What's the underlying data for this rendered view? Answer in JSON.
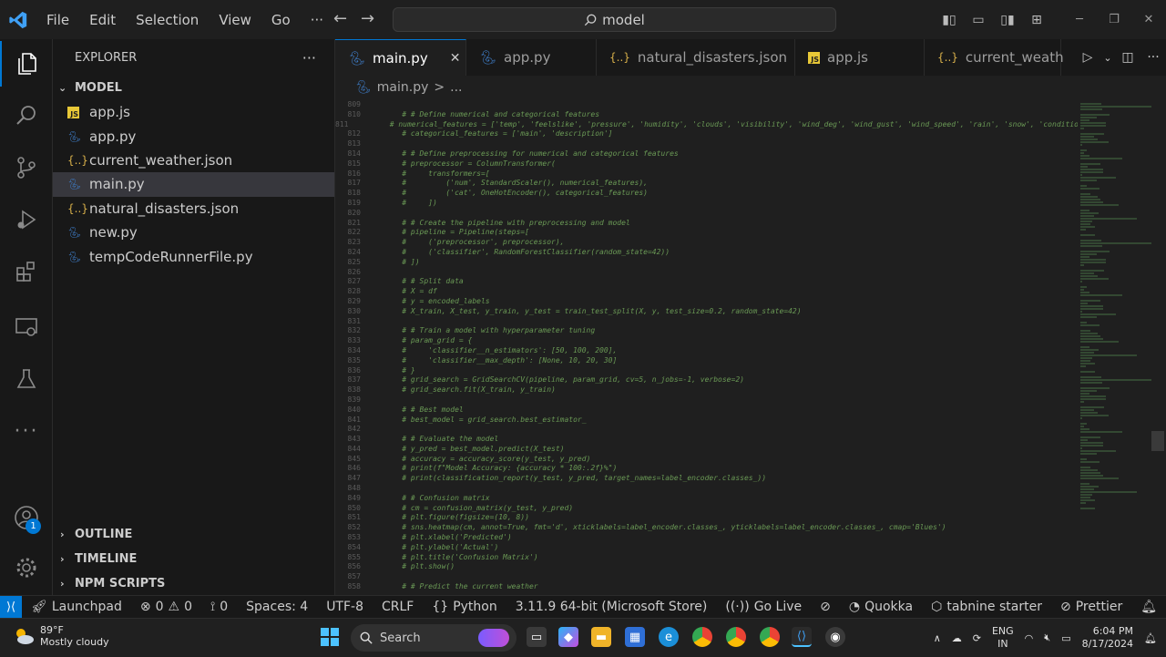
{
  "titlebar": {
    "menu": [
      "File",
      "Edit",
      "Selection",
      "View",
      "Go"
    ],
    "more": "···",
    "search_text": "model"
  },
  "sidebar": {
    "title": "EXPLORER",
    "more": "···",
    "folder": "MODEL",
    "files": [
      {
        "name": "app.js",
        "icon": "js"
      },
      {
        "name": "app.py",
        "icon": "py"
      },
      {
        "name": "current_weather.json",
        "icon": "json"
      },
      {
        "name": "main.py",
        "icon": "py",
        "selected": true
      },
      {
        "name": "natural_disasters.json",
        "icon": "json"
      },
      {
        "name": "new.py",
        "icon": "py"
      },
      {
        "name": "tempCodeRunnerFile.py",
        "icon": "py"
      }
    ],
    "sections": [
      "OUTLINE",
      "TIMELINE",
      "NPM SCRIPTS"
    ]
  },
  "activity_badge": "1",
  "tabs": [
    {
      "label": "main.py",
      "icon": "py",
      "active": true
    },
    {
      "label": "app.py",
      "icon": "py"
    },
    {
      "label": "natural_disasters.json",
      "icon": "json"
    },
    {
      "label": "app.js",
      "icon": "js"
    },
    {
      "label": "current_weath",
      "icon": "json"
    }
  ],
  "breadcrumb": {
    "file": "main.py",
    "sep": ">",
    "rest": "..."
  },
  "code_lines": [
    {
      "n": "809",
      "t": ""
    },
    {
      "n": "810",
      "t": "    # # Define numerical and categorical features"
    },
    {
      "n": "811",
      "t": "    # numerical_features = ['temp', 'feelslike', 'pressure', 'humidity', 'clouds', 'visibility', 'wind_deg', 'wind_gust', 'wind_speed', 'rain', 'snow', 'conditionId']"
    },
    {
      "n": "812",
      "t": "    # categorical_features = ['main', 'description']"
    },
    {
      "n": "813",
      "t": ""
    },
    {
      "n": "814",
      "t": "    # # Define preprocessing for numerical and categorical features"
    },
    {
      "n": "815",
      "t": "    # preprocessor = ColumnTransformer("
    },
    {
      "n": "816",
      "t": "    #     transformers=["
    },
    {
      "n": "817",
      "t": "    #         ('num', StandardScaler(), numerical_features),"
    },
    {
      "n": "818",
      "t": "    #         ('cat', OneHotEncoder(), categorical_features)"
    },
    {
      "n": "819",
      "t": "    #     ])"
    },
    {
      "n": "820",
      "t": ""
    },
    {
      "n": "821",
      "t": "    # # Create the pipeline with preprocessing and model"
    },
    {
      "n": "822",
      "t": "    # pipeline = Pipeline(steps=["
    },
    {
      "n": "823",
      "t": "    #     ('preprocessor', preprocessor),"
    },
    {
      "n": "824",
      "t": "    #     ('classifier', RandomForestClassifier(random_state=42))"
    },
    {
      "n": "825",
      "t": "    # ])"
    },
    {
      "n": "826",
      "t": ""
    },
    {
      "n": "827",
      "t": "    # # Split data"
    },
    {
      "n": "828",
      "t": "    # X = df"
    },
    {
      "n": "829",
      "t": "    # y = encoded_labels"
    },
    {
      "n": "830",
      "t": "    # X_train, X_test, y_train, y_test = train_test_split(X, y, test_size=0.2, random_state=42)"
    },
    {
      "n": "831",
      "t": ""
    },
    {
      "n": "832",
      "t": "    # # Train a model with hyperparameter tuning"
    },
    {
      "n": "833",
      "t": "    # param_grid = {"
    },
    {
      "n": "834",
      "t": "    #     'classifier__n_estimators': [50, 100, 200],"
    },
    {
      "n": "835",
      "t": "    #     'classifier__max_depth': [None, 10, 20, 30]"
    },
    {
      "n": "836",
      "t": "    # }"
    },
    {
      "n": "837",
      "t": "    # grid_search = GridSearchCV(pipeline, param_grid, cv=5, n_jobs=-1, verbose=2)"
    },
    {
      "n": "838",
      "t": "    # grid_search.fit(X_train, y_train)"
    },
    {
      "n": "839",
      "t": ""
    },
    {
      "n": "840",
      "t": "    # # Best model"
    },
    {
      "n": "841",
      "t": "    # best_model = grid_search.best_estimator_"
    },
    {
      "n": "842",
      "t": ""
    },
    {
      "n": "843",
      "t": "    # # Evaluate the model"
    },
    {
      "n": "844",
      "t": "    # y_pred = best_model.predict(X_test)"
    },
    {
      "n": "845",
      "t": "    # accuracy = accuracy_score(y_test, y_pred)"
    },
    {
      "n": "846",
      "t": "    # print(f\"Model Accuracy: {accuracy * 100:.2f}%\")"
    },
    {
      "n": "847",
      "t": "    # print(classification_report(y_test, y_pred, target_names=label_encoder.classes_))"
    },
    {
      "n": "848",
      "t": ""
    },
    {
      "n": "849",
      "t": "    # # Confusion matrix"
    },
    {
      "n": "850",
      "t": "    # cm = confusion_matrix(y_test, y_pred)"
    },
    {
      "n": "851",
      "t": "    # plt.figure(figsize=(10, 8))"
    },
    {
      "n": "852",
      "t": "    # sns.heatmap(cm, annot=True, fmt='d', xticklabels=label_encoder.classes_, yticklabels=label_encoder.classes_, cmap='Blues')"
    },
    {
      "n": "853",
      "t": "    # plt.xlabel('Predicted')"
    },
    {
      "n": "854",
      "t": "    # plt.ylabel('Actual')"
    },
    {
      "n": "855",
      "t": "    # plt.title('Confusion Matrix')"
    },
    {
      "n": "856",
      "t": "    # plt.show()"
    },
    {
      "n": "857",
      "t": ""
    },
    {
      "n": "858",
      "t": "    # # Predict the current weather"
    }
  ],
  "statusbar": {
    "launchpad": "Launchpad",
    "errors": "0",
    "warnings": "0",
    "ports": "0",
    "spaces": "Spaces: 4",
    "encoding": "UTF-8",
    "eol": "CRLF",
    "language": "Python",
    "interpreter": "3.11.9 64-bit (Microsoft Store)",
    "golive": "Go Live",
    "quokka": "Quokka",
    "tabnine": "tabnine starter",
    "prettier": "Prettier"
  },
  "taskbar": {
    "temperature": "89°F",
    "weather": "Mostly cloudy",
    "search": "Search",
    "lang": "ENG",
    "region": "IN",
    "time": "6:04 PM",
    "date": "8/17/2024"
  },
  "colors": {
    "accent": "#0078d4",
    "comment": "#6a9955",
    "selection": "#37373d"
  }
}
